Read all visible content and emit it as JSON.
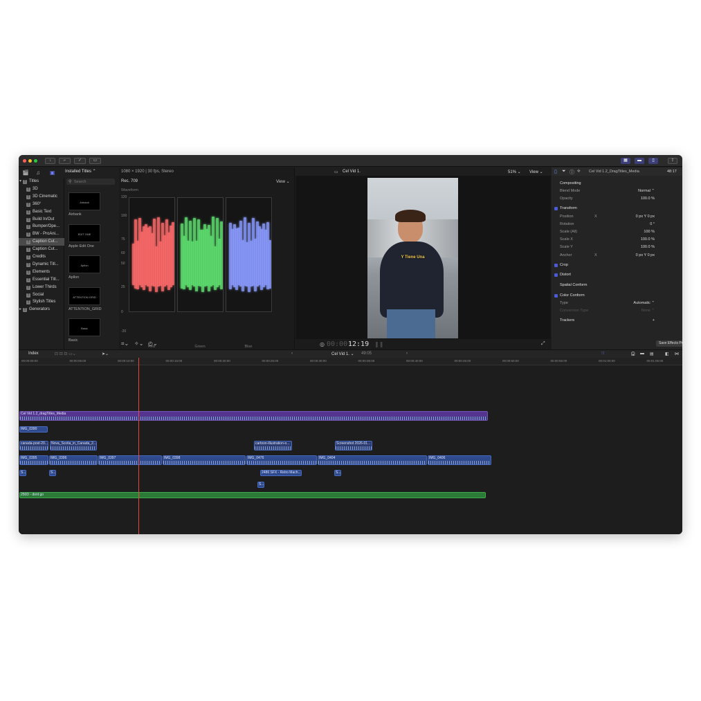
{
  "toolbar": {
    "buttons": [
      "download-icon",
      "key-icon",
      "check-icon",
      "tag-icon"
    ],
    "right_buttons": [
      "grid-icon",
      "film-icon",
      "panel-icon",
      "share-icon"
    ]
  },
  "browser": {
    "header": "Installed Titles ⌃",
    "search_placeholder": "Search",
    "categories": [
      {
        "label": "Titles",
        "selected": false
      },
      {
        "label": "3D"
      },
      {
        "label": "3D Cinematic"
      },
      {
        "label": "360°"
      },
      {
        "label": "Basic Text"
      },
      {
        "label": "Build In/Out"
      },
      {
        "label": "Bumper/Ope..."
      },
      {
        "label": "BW - ProAni..."
      },
      {
        "label": "Caption Cut...",
        "selected": true
      },
      {
        "label": "Caption Cut..."
      },
      {
        "label": "Credits"
      },
      {
        "label": "Dynamic Titl..."
      },
      {
        "label": "Elements"
      },
      {
        "label": "Essential Titl..."
      },
      {
        "label": "Lower Thirds"
      },
      {
        "label": "Social"
      },
      {
        "label": "Stylish Titles"
      },
      {
        "label": "Generators"
      }
    ],
    "thumbs": [
      {
        "label": "Airbank",
        "preview": "Airbank"
      },
      {
        "label": "Apple Edit One",
        "preview": "EDIT ONE"
      },
      {
        "label": "Apllon",
        "preview": "Apllon"
      },
      {
        "label": "ATTENTION_GRID",
        "preview": "ATTENTION GRID"
      },
      {
        "label": "Basic",
        "preview": "Basic"
      }
    ]
  },
  "scope": {
    "format": "1080 × 1920 | 30 fps, Stereo",
    "mode": "Rec. 709",
    "view_label": "View ⌄",
    "scope_name": "Waveform",
    "y_ticks": [
      "120",
      "100",
      "75",
      "60",
      "50",
      "25",
      "0",
      "-20"
    ],
    "channels": [
      "Red",
      "Green",
      "Blue"
    ],
    "colors": {
      "red": "#ff6b6b",
      "green": "#5fe070",
      "blue": "#8a9bff"
    }
  },
  "viewer": {
    "clip_title": "Cel Vid 1.",
    "zoom": "51% ⌄",
    "view_label": "View ⌄",
    "caption": "Y Tiene Una",
    "timecode_dim": "00:00:",
    "timecode": "12:19"
  },
  "inspector": {
    "clip_title": "Cel Vid 1.2_DragTitles_Media",
    "duration": "48:17",
    "rows": [
      {
        "label": "Compositing",
        "value": "",
        "section": true
      },
      {
        "label": "Blend Mode",
        "value": "Normal ⌃"
      },
      {
        "label": "Opacity",
        "value": "100.0 %"
      },
      {
        "label": "Transform",
        "value": "",
        "section": true,
        "check": true
      },
      {
        "label": "Position",
        "value": "0 px   Y   0 px",
        "axis": "X"
      },
      {
        "label": "Rotation",
        "value": "0 °"
      },
      {
        "label": "Scale (All)",
        "value": "100 %"
      },
      {
        "label": "Scale X",
        "value": "100.0 %"
      },
      {
        "label": "Scale Y",
        "value": "100.0 %"
      },
      {
        "label": "Anchor",
        "value": "0 px   Y   0 px",
        "axis": "X"
      },
      {
        "label": "Crop",
        "value": "",
        "section": true,
        "check": true
      },
      {
        "label": "Distort",
        "value": "",
        "section": true,
        "check": true
      },
      {
        "label": "Spatial Conform",
        "value": "",
        "section": true
      },
      {
        "label": "Color Conform",
        "value": "",
        "section": true,
        "check": true
      },
      {
        "label": "Type",
        "value": "Automatic ⌃"
      },
      {
        "label": "Conversion Type",
        "value": "None ⌃",
        "dim": true
      },
      {
        "label": "Trackers",
        "value": "+",
        "section": true
      }
    ],
    "save_preset": "Save Effects Preset"
  },
  "timeline": {
    "index_label": "Index",
    "project": "Cel Vid 1.  ⌄",
    "duration": "49:05",
    "ruler": [
      "00:00:00:00",
      "00:00:05:00",
      "00:00:10:00",
      "00:00:15:00",
      "00:00:20:00",
      "00:00:25:00",
      "00:00:30:00",
      "00:00:35:00",
      "00:00:40:00",
      "00:00:45:00",
      "00:00:50:00",
      "00:00:55:00",
      "00:01:00:00",
      "00:01:05:00"
    ],
    "main_clip": "Cel Vid 1.2_dragTitles_Media",
    "clips_top": [
      {
        "label": "IMG_0390"
      }
    ],
    "clips_titles": [
      {
        "label": "canada-post-20..."
      },
      {
        "label": "Nova_Scotia_in_Canada_2..."
      },
      {
        "label": "cartoon-illustration-o..."
      },
      {
        "label": "Screenshot 2026-01..."
      }
    ],
    "clips_main": [
      {
        "label": "IMG_0395"
      },
      {
        "label": "IMG_0396"
      },
      {
        "label": "IMG_0397"
      },
      {
        "label": "IMG_0398"
      },
      {
        "label": "IMG_0476"
      },
      {
        "label": "IMG_0404"
      },
      {
        "label": "IMG_0406"
      }
    ],
    "clips_small": [
      {
        "label": "S..."
      },
      {
        "label": "S..."
      },
      {
        "label": "S..."
      },
      {
        "label": "2486 SFX - Retro Mach..."
      },
      {
        "label": "S..."
      }
    ],
    "audio_clip": "250D - dont go"
  }
}
